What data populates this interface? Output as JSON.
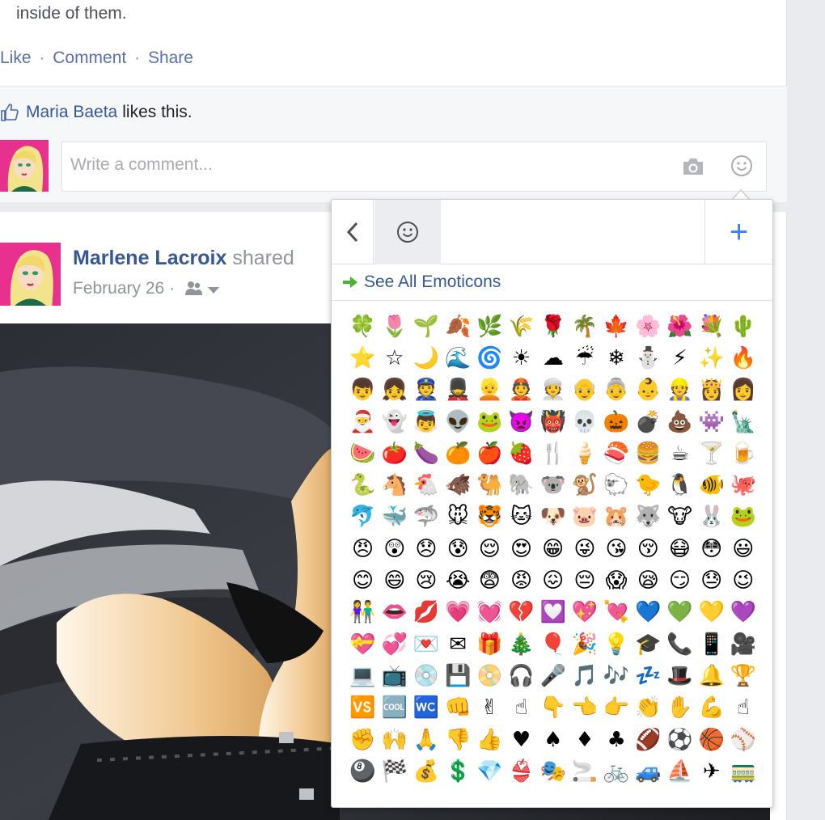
{
  "post1": {
    "text": "inside of them.",
    "actions": {
      "like": "Like",
      "comment": "Comment",
      "share": "Share",
      "separator": "·"
    },
    "likes": {
      "name": "Maria Baeta",
      "rest": "likes this."
    },
    "comment": {
      "placeholder": "Write a comment..."
    }
  },
  "post2": {
    "author": "Marlene Lacroix",
    "verb": "shared",
    "date": "February 26",
    "date_separator": "·"
  },
  "emoji_picker": {
    "see_all": "See All Emoticons",
    "add_symbol": "+",
    "accent_color": "#4080ff",
    "link_color": "#365899",
    "arrow_color": "#42b72a",
    "emoji": [
      "🍀",
      "🌷",
      "🌱",
      "🍂",
      "🌿",
      "🌾",
      "🌹",
      "🌴",
      "🍁",
      "🌸",
      "🌺",
      "💐",
      "🌵",
      "⭐",
      "☆",
      "🌙",
      "🌊",
      "🌀",
      "☀",
      "☁",
      "☔",
      "❄",
      "⛄",
      "⚡",
      "✨",
      "🔥",
      "👦",
      "👧",
      "👮",
      "💂",
      "👱",
      "👲",
      "👳",
      "👴",
      "👵",
      "👶",
      "👷",
      "👸",
      "👩",
      "🎅",
      "👻",
      "👼",
      "👽",
      "🐸",
      "👿",
      "👹",
      "💀",
      "🎃",
      "💣",
      "💩",
      "👾",
      "🗽",
      "🍉",
      "🍅",
      "🍆",
      "🍊",
      "🍎",
      "🍓",
      "🍴",
      "🍦",
      "🍣",
      "🍔",
      "☕",
      "🍸",
      "🍺",
      "🐍",
      "🐴",
      "🐔",
      "🐗",
      "🐫",
      "🐘",
      "🐨",
      "🐒",
      "🐑",
      "🐤",
      "🐧",
      "🐠",
      "🐙",
      "🐬",
      "🐳",
      "🦈",
      "🐭",
      "🐯",
      "🐱",
      "🐶",
      "🐷",
      "🐹",
      "🐺",
      "🐮",
      "🐰",
      "🐸",
      "😠",
      "😲",
      "😞",
      "😰",
      "😌",
      "😍",
      "😁",
      "😜",
      "😘",
      "😚",
      "😷",
      "😳",
      "😃",
      "😊",
      "😄",
      "😢",
      "😭",
      "😨",
      "😡",
      "😖",
      "😔",
      "😱",
      "😪",
      "😏",
      "😓",
      "😉",
      "👫",
      "👄",
      "💋",
      "💗",
      "💓",
      "💔",
      "💟",
      "💖",
      "💘",
      "💙",
      "💚",
      "💛",
      "💜",
      "💝",
      "💞",
      "💌",
      "✉",
      "🎁",
      "🎄",
      "🎈",
      "🎉",
      "💡",
      "🎓",
      "📞",
      "📱",
      "🎥",
      "💻",
      "📺",
      "💿",
      "💾",
      "📀",
      "🎧",
      "🎤",
      "🎵",
      "🎶",
      "💤",
      "🎩",
      "🔔",
      "🏆",
      "🆚",
      "🆒",
      "🚾",
      "👊",
      "✌",
      "☝",
      "👇",
      "👈",
      "👉",
      "👏",
      "✋",
      "💪",
      "☝",
      "✊",
      "🙌",
      "🙏",
      "👎",
      "👍",
      "♥",
      "♠",
      "♦",
      "♣",
      "🏈",
      "⚽",
      "🏀",
      "⚾",
      "🎱",
      "🏁",
      "💰",
      "💲",
      "💎",
      "👙",
      "🎭",
      "🚬",
      "🚲",
      "🚙",
      "⛵",
      "✈",
      "🚃"
    ]
  }
}
